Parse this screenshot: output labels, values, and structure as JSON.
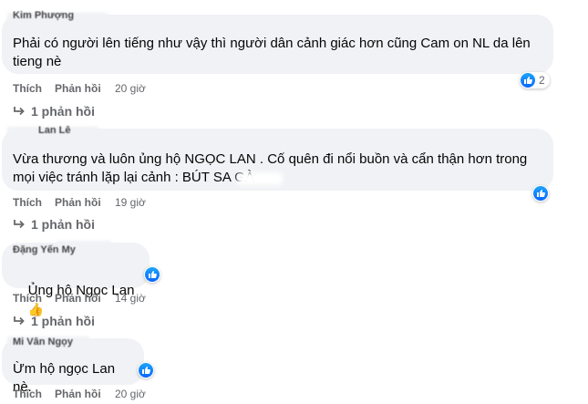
{
  "comments": [
    {
      "author": "Kim Phượng",
      "text": "Phải có người lên tiếng như vậy thì người dân cảnh giác hơn cũng Cam on NL da lên\ntieng nè",
      "like_label": "Thích",
      "reply_label": "Phản hồi",
      "time": "20 giờ",
      "reaction_count": "2",
      "replies_label": "1 phản hồi"
    },
    {
      "author": "Lan Lê",
      "text": "Vừa thương và luôn ủng hộ NGỌC LAN . Cố quên đi nổi buồn và cẩn thận hơn trong\nmọi việc tránh lặp lại cảnh : BÚT SA GÀ",
      "like_label": "Thích",
      "reply_label": "Phản hồi",
      "time": "19 giờ",
      "replies_label": "1 phản hồi"
    },
    {
      "author": "Đặng Yến My",
      "text": "Ủng hộ Ngọc Lan",
      "emoji": "👍",
      "like_label": "Thích",
      "reply_label": "Phản hồi",
      "time": "14 giờ",
      "replies_label": "1 phản hồi"
    },
    {
      "author": "Mi Vân Ngọy",
      "text": "Ừm hộ ngọc Lan nè.",
      "like_label": "Thích",
      "reply_label": "Phản hồi",
      "time": "20 giờ"
    }
  ],
  "colors": {
    "bubble": "#f0f2f5",
    "muted": "#65676b",
    "like_blue": "#0866ff"
  },
  "icons": {
    "reaction": "like-thumb-icon",
    "reply_arrow": "reply-arrow-icon"
  }
}
